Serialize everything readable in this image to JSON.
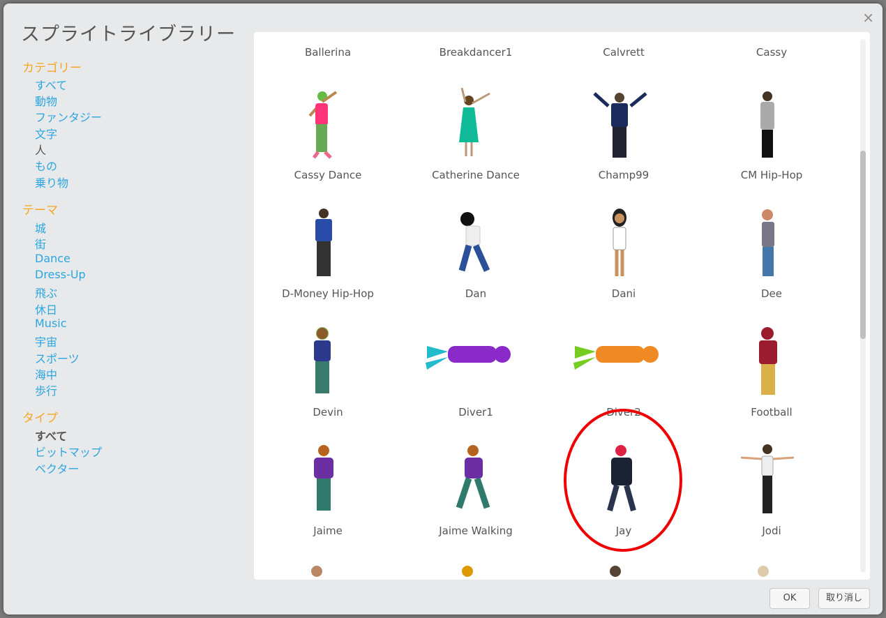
{
  "dialog": {
    "title": "スプライトライブラリー",
    "close": "×"
  },
  "sidebar": {
    "category_header": "カテゴリー",
    "categories": [
      "すべて",
      "動物",
      "ファンタジー",
      "文字",
      "人",
      "もの",
      "乗り物"
    ],
    "theme_header": "テーマ",
    "themes": [
      "城",
      "街",
      "Dance",
      "Dress-Up",
      "飛ぶ",
      "休日",
      "Music",
      "宇宙",
      "スポーツ",
      "海中",
      "歩行"
    ],
    "type_header": "タイプ",
    "types": [
      "すべて",
      "ビットマップ",
      "ベクター"
    ]
  },
  "sprites": {
    "row0": [
      "Ballerina",
      "Breakdancer1",
      "Calvrett",
      "Cassy"
    ],
    "row1": [
      "Cassy Dance",
      "Catherine Dance",
      "Champ99",
      "CM Hip-Hop"
    ],
    "row2": [
      "D-Money Hip-Hop",
      "Dan",
      "Dani",
      "Dee"
    ],
    "row3": [
      "Devin",
      "Diver1",
      "Diver2",
      "Football"
    ],
    "row4": [
      "Jaime",
      "Jaime Walking",
      "Jay",
      "Jodi"
    ]
  },
  "buttons": {
    "ok": "OK",
    "cancel": "取り消し"
  },
  "colors": {
    "accent_orange": "#f5a623",
    "link_blue": "#2aa6df",
    "highlight_ring": "#e00000"
  }
}
